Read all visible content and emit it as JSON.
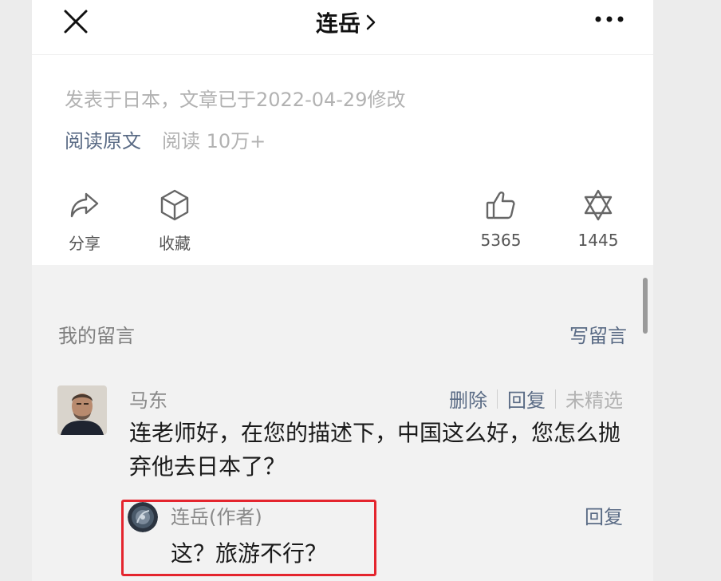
{
  "header": {
    "title": "连岳",
    "close_icon": "close-icon",
    "more_icon": "more-dots-icon"
  },
  "article": {
    "publish_info": "发表于日本，文章已于2022-04-29修改",
    "read_original": "阅读原文",
    "read_count": "阅读 10万+"
  },
  "actions": {
    "share": {
      "label": "分享",
      "icon": "share-icon"
    },
    "collect": {
      "label": "收藏",
      "icon": "box-icon"
    },
    "like": {
      "count": "5365",
      "icon": "thumbs-up-icon"
    },
    "wow": {
      "count": "1445",
      "icon": "star-of-david-icon"
    }
  },
  "comments": {
    "section_title": "我的留言",
    "write_label": "写留言",
    "items": [
      {
        "name": "马东",
        "delete_label": "删除",
        "reply_label": "回复",
        "status_label": "未精选",
        "text": "连老师好，在您的描述下，中国这么好，您怎么抛弃他去日本了？",
        "reply": {
          "name": "连岳(作者)",
          "reply_label": "回复",
          "text": "这？旅游不行？"
        }
      }
    ]
  },
  "colors": {
    "link": "#5a6b85",
    "highlight_box": "#e4252e"
  }
}
